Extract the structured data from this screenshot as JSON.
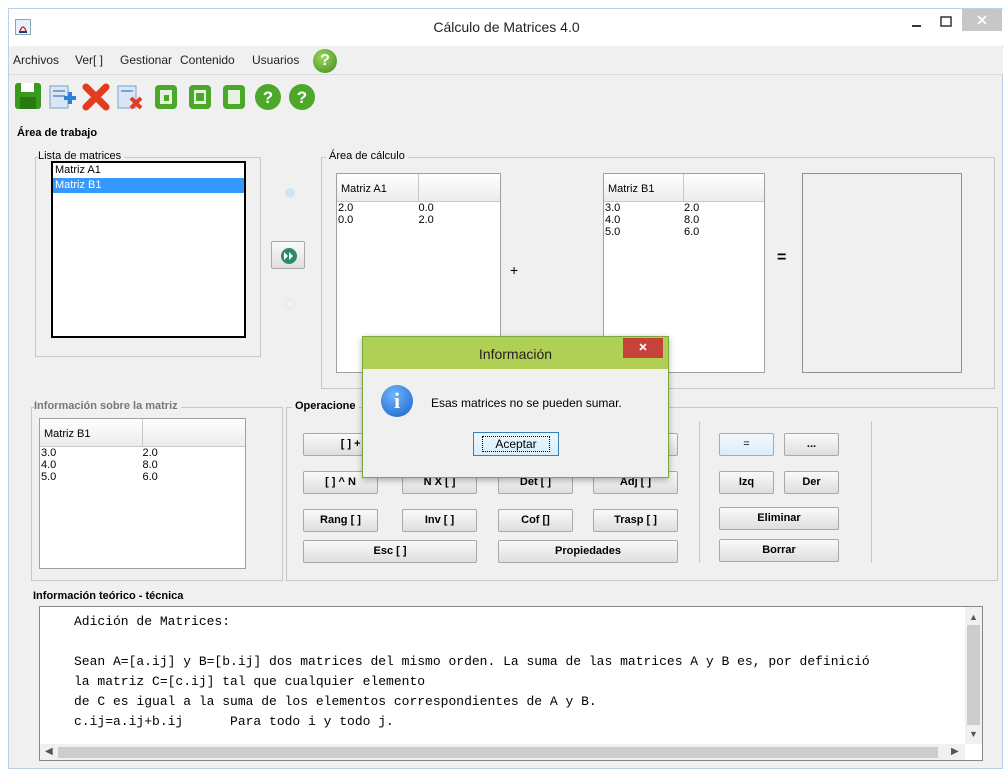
{
  "window": {
    "title": "Cálculo de Matrices 4.0"
  },
  "menu": [
    "Archivos",
    "Ver[ ]",
    "Gestionar",
    "Contenido",
    "Usuarios"
  ],
  "toolbar_icons": [
    "save-icon",
    "add-icon",
    "delete-icon",
    "remove-icon",
    "open-icon",
    "copy-icon",
    "clipboard-icon",
    "help-icon",
    "about-icon"
  ],
  "workarea": {
    "title": "Área de trabajo",
    "list_title": "Lista de matrices",
    "list": [
      "Matriz A1",
      "Matriz B1"
    ],
    "selected": "Matriz B1",
    "calc_title": "Área de cálculo",
    "matrix_a": {
      "header": "Matriz A1",
      "rows": [
        [
          "2.0",
          "0.0"
        ],
        [
          "0.0",
          "2.0"
        ]
      ]
    },
    "operator": "+",
    "matrix_b": {
      "header": "Matriz B1",
      "rows": [
        [
          "3.0",
          "2.0"
        ],
        [
          "4.0",
          "8.0"
        ],
        [
          "5.0",
          "6.0"
        ]
      ]
    },
    "equals": "="
  },
  "info": {
    "title": "Información sobre la matriz",
    "header": "Matriz B1",
    "rows": [
      [
        "3.0",
        "2.0"
      ],
      [
        "4.0",
        "8.0"
      ],
      [
        "5.0",
        "6.0"
      ]
    ]
  },
  "operations": {
    "title": "Operacione",
    "b1": "[ ] + [",
    "b2": "[ ] ^ N",
    "b3": "N X [ ]",
    "b4": "Det [ ]",
    "b5": "Adj [ ]",
    "b6": "Rang [ ]",
    "b7": "Inv [ ]",
    "b8": "Cof []",
    "b9": "Trasp [ ]",
    "b10": "Esc [ ]",
    "b11": "Propiedades",
    "eq": "=",
    "more": "...",
    "izq": "Izq",
    "der": "Der",
    "eliminar": "Eliminar",
    "borrar": "Borrar"
  },
  "theory": {
    "title": "Información teórico - técnica",
    "l1": "Adición de Matrices:",
    "l2": "Sean A=[a.ij] y B=[b.ij] dos matrices del mismo orden. La suma de las matrices A y B es, por definició",
    "l3": "la matriz C=[c.ij] tal que cualquier elemento",
    "l4": "de C es igual a la suma de los elementos correspondientes de A y B.",
    "l5": "c.ij=a.ij+b.ij      Para todo i y todo j."
  },
  "dialog": {
    "title": "Información",
    "message": "Esas matrices no se pueden sumar.",
    "accept": "Aceptar"
  }
}
